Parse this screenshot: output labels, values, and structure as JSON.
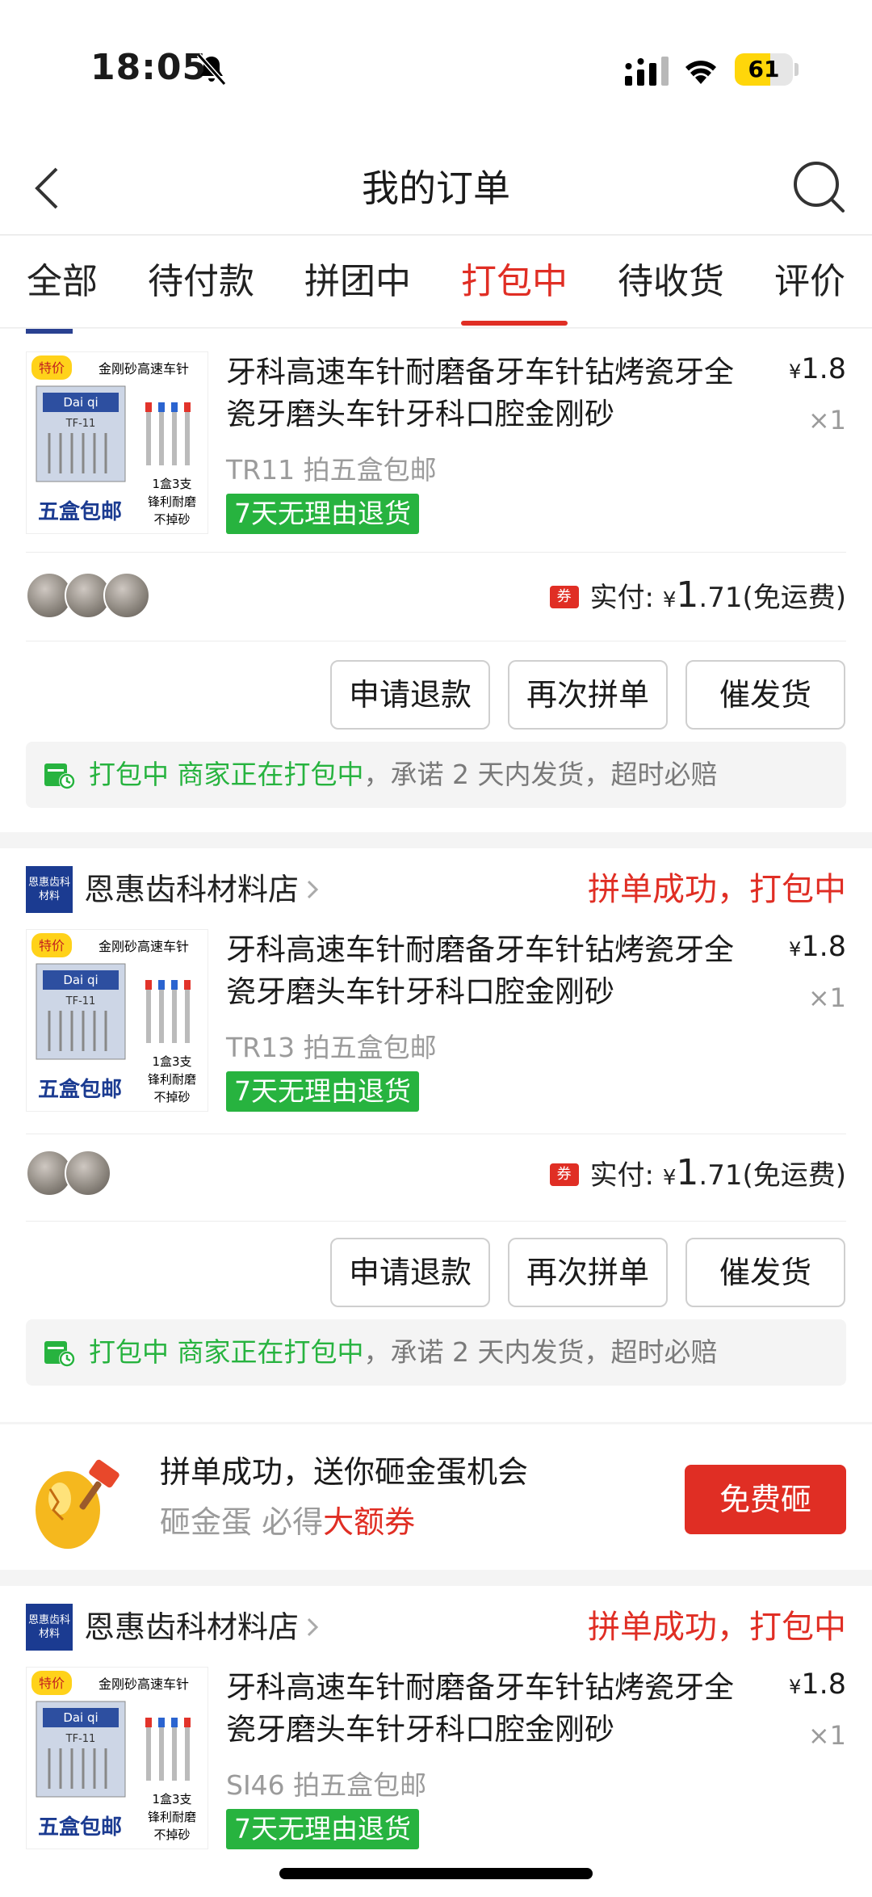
{
  "status_bar": {
    "time": "18:05",
    "battery": "61",
    "battery_fill_fraction": 0.61,
    "icons": [
      "bell-slash-icon",
      "cellular-signal-icon",
      "wifi-icon",
      "battery-icon"
    ]
  },
  "header": {
    "title": "我的订单",
    "icons": [
      "back-icon",
      "search-icon"
    ]
  },
  "tabs": [
    {
      "label": "全部",
      "active": false
    },
    {
      "label": "待付款",
      "active": false
    },
    {
      "label": "拼团中",
      "active": false
    },
    {
      "label": "打包中",
      "active": true
    },
    {
      "label": "待收货",
      "active": false
    },
    {
      "label": "评价",
      "active": false
    }
  ],
  "common": {
    "paid_label": "实付:",
    "coupon_icon_text": "券",
    "currency": "¥",
    "free_shipping": "(免运费)",
    "buttons": [
      "申请退款",
      "再次拼单",
      "催发货"
    ],
    "notice_status": "打包中",
    "notice_merchant": "商家正在打包中",
    "notice_promise": "，承诺 2 天内发货，超时必赔",
    "return_badge": "7天无理由退货",
    "thumb_text": {
      "tag": "特价",
      "header": "金刚砂高速车针",
      "brand": "Dai qi",
      "model": "TF-11",
      "pack": "1盒3支",
      "feature": "锋利耐磨",
      "feature2": "不掉砂",
      "promo": "五盒包邮"
    }
  },
  "orders": [
    {
      "shop_name": "",
      "shop_logo_text": "",
      "status": "",
      "product_title": "牙科高速车针耐磨备牙车针钻烤瓷牙全瓷牙磨头车针牙科口腔金刚砂",
      "spec": "TR11 拍五盒包邮",
      "price": "1.8",
      "quantity": "×1",
      "paid_integer": "1",
      "paid_decimal": ".71",
      "participants": 3
    },
    {
      "shop_name": "恩惠齿科材料店",
      "shop_logo_text": "恩惠齿科 材料",
      "status": "拼单成功，打包中",
      "product_title": "牙科高速车针耐磨备牙车针钻烤瓷牙全瓷牙磨头车针牙科口腔金刚砂",
      "spec": "TR13 拍五盒包邮",
      "price": "1.8",
      "quantity": "×1",
      "paid_integer": "1",
      "paid_decimal": ".71",
      "participants": 2
    },
    {
      "shop_name": "恩惠齿科材料店",
      "shop_logo_text": "恩惠齿科 材料",
      "status": "拼单成功，打包中",
      "product_title": "牙科高速车针耐磨备牙车针钻烤瓷牙全瓷牙磨头车针牙科口腔金刚砂",
      "spec": "SI46 拍五盒包邮",
      "price": "1.8",
      "quantity": "×1"
    }
  ],
  "promo": {
    "title": "拼单成功，送你砸金蛋机会",
    "sub_prefix": "砸金蛋 必得",
    "sub_highlight": "大额券",
    "button": "免费砸"
  },
  "colors": {
    "accent_red": "#e02e24",
    "green": "#27b33f",
    "shop_logo_blue": "#1b3b91",
    "battery_yellow": "#ffd60a"
  }
}
